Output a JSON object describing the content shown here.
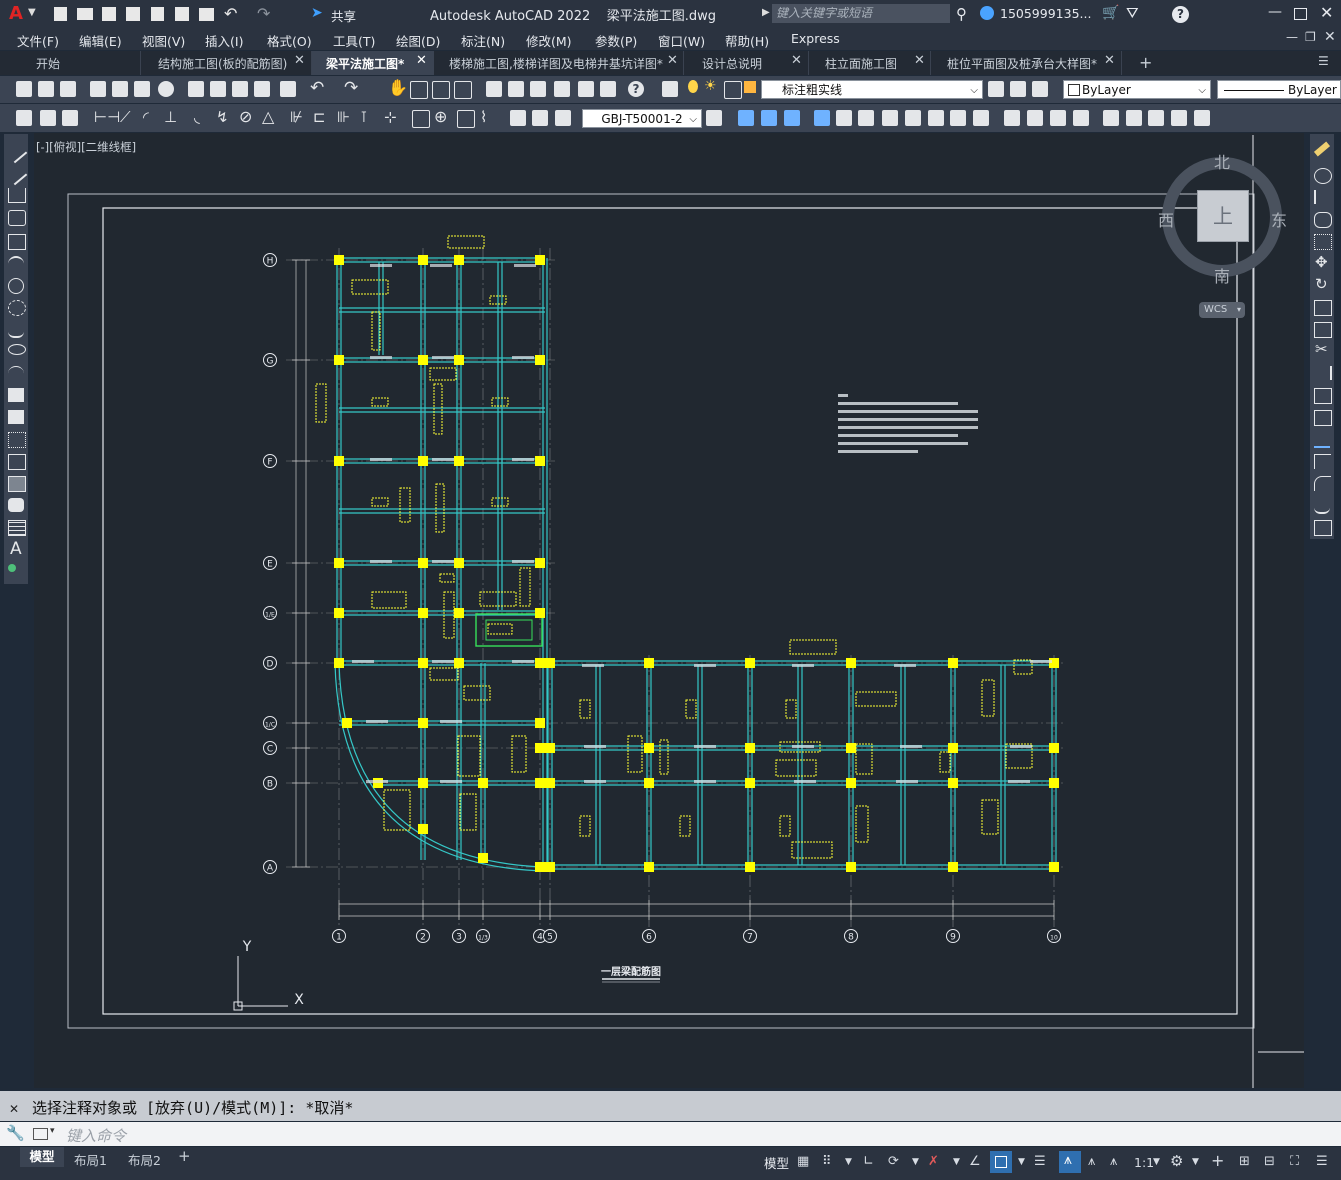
{
  "app": {
    "logo": "A",
    "share_label": "共享",
    "title": "Autodesk AutoCAD 2022    梁平法施工图.dwg",
    "search_placeholder": "键入关键字或短语",
    "user": "1505999135...",
    "help_icon": "?"
  },
  "menus": [
    "文件(F)",
    "编辑(E)",
    "视图(V)",
    "插入(I)",
    "格式(O)",
    "工具(T)",
    "绘图(D)",
    "标注(N)",
    "修改(M)",
    "参数(P)",
    "窗口(W)",
    "帮助(H)",
    "Express"
  ],
  "tabs": [
    {
      "label": "开始",
      "active": false
    },
    {
      "label": "结构施工图(板的配筋图)",
      "active": false
    },
    {
      "label": "梁平法施工图*",
      "active": true
    },
    {
      "label": "楼梯施工图,楼梯详图及电梯井基坑详图*",
      "active": false
    },
    {
      "label": "设计总说明",
      "active": false
    },
    {
      "label": "柱立面施工图",
      "active": false
    },
    {
      "label": "桩位平面图及桩承台大样图*",
      "active": false
    }
  ],
  "toolbar": {
    "layer_value": "标注粗实线",
    "color_value": "ByLayer",
    "linetype_value": "ByLayer",
    "dimstyle_value": "GBJ-T50001-2"
  },
  "viewport": {
    "label": "[-][俯视][二维线框]",
    "viewcube": {
      "north": "北",
      "south": "南",
      "west": "西",
      "east": "东",
      "face": "上"
    },
    "wcs": "WCS",
    "ucs_x": "X",
    "ucs_y": "Y"
  },
  "drawing": {
    "title": "一层梁配筋图",
    "axis_rows": [
      "H",
      "G",
      "F",
      "E",
      "1/E",
      "D",
      "1/C",
      "C",
      "B",
      "A"
    ],
    "axis_cols": [
      "1",
      "2",
      "3",
      "1/3",
      "4",
      "5",
      "6",
      "7",
      "8",
      "9",
      "10"
    ]
  },
  "command": {
    "history": "选择注释对象或 [放弃(U)/模式(M)]: *取消*",
    "input_placeholder": "键入命令"
  },
  "status": {
    "layout_tabs": [
      {
        "label": "模型",
        "active": true
      },
      {
        "label": "布局1",
        "active": false
      },
      {
        "label": "布局2",
        "active": false
      }
    ],
    "model_label": "模型",
    "scale": "1:1"
  },
  "colors": {
    "beam": "#35c7c7",
    "column": "#ffff00",
    "annotation": "#ffff33",
    "axis": "#c8c8c8",
    "canvas_bg": "#212830"
  }
}
